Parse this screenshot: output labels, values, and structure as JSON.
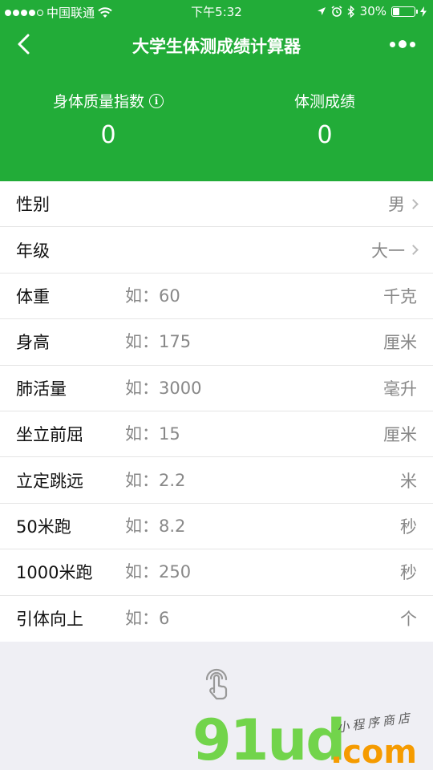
{
  "status_bar": {
    "carrier": "中国联通",
    "time": "下午5:32",
    "battery": "30%",
    "battery_level": 0.3
  },
  "navbar": {
    "title": "大学生体测成绩计算器"
  },
  "stats": {
    "bmi_label": "身体质量指数",
    "bmi_value": "0",
    "score_label": "体测成绩",
    "score_value": "0"
  },
  "form": {
    "gender": {
      "label": "性别",
      "value": "男"
    },
    "grade": {
      "label": "年级",
      "value": "大一"
    },
    "fields": [
      {
        "label": "体重",
        "placeholder": "如：60",
        "unit": "千克"
      },
      {
        "label": "身高",
        "placeholder": "如：175",
        "unit": "厘米"
      },
      {
        "label": "肺活量",
        "placeholder": "如：3000",
        "unit": "毫升"
      },
      {
        "label": "坐立前屈",
        "placeholder": "如：15",
        "unit": "厘米"
      },
      {
        "label": "立定跳远",
        "placeholder": "如：2.2",
        "unit": "米"
      },
      {
        "label": "50米跑",
        "placeholder": "如：8.2",
        "unit": "秒"
      },
      {
        "label": "1000米跑",
        "placeholder": "如：250",
        "unit": "秒"
      },
      {
        "label": "引体向上",
        "placeholder": "如：6",
        "unit": "个"
      }
    ]
  },
  "watermark": {
    "logo": "91ud",
    "domain": ".com",
    "sub": "小程序商店"
  }
}
